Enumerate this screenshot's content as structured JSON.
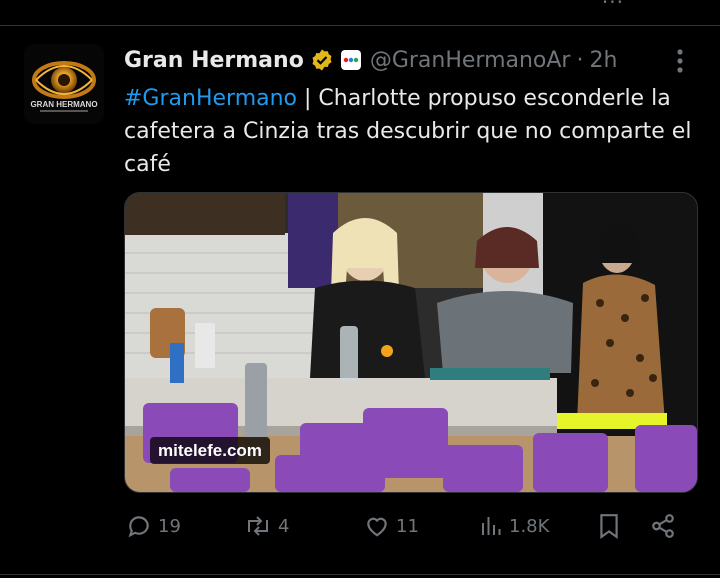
{
  "tweet": {
    "author_name": "Gran Hermano",
    "handle": "@GranHermanoAr",
    "separator": "·",
    "time": "2h",
    "hashtag": "#GranHermano",
    "text": " | Charlotte propuso esconderle la cafetera a Cinzia tras descubrir que no comparte el café",
    "avatar_icon": "gran-hermano-eye-logo",
    "avatar_logo_text": "GRAN HERMANO",
    "verified_icon": "gold-verified-badge",
    "affiliate_icon": "telefe-affiliate-badge",
    "media": {
      "watermark": "mitelefe.com",
      "description_icon": "kitchen-scene-photo"
    },
    "actions": {
      "replies": "19",
      "retweets": "4",
      "likes": "11",
      "views": "1.8K"
    }
  },
  "colors": {
    "background": "#000000",
    "text": "#e7e9ea",
    "muted": "#71767b",
    "link": "#1d9bf0",
    "verified_gold": "#e2b719"
  }
}
